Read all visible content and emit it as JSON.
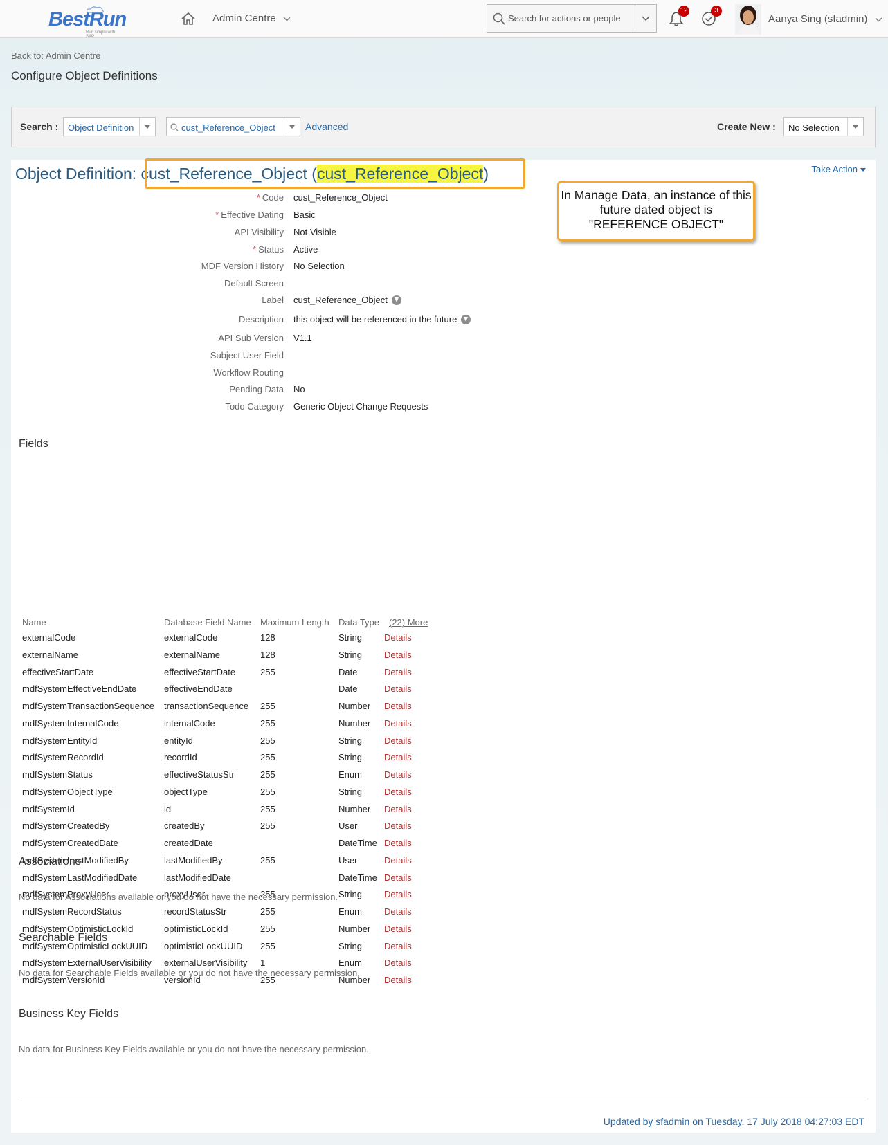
{
  "header": {
    "logo_text": "BestRun",
    "logo_tagline": "Run simple with SAP",
    "nav_title": "Admin Centre",
    "search_placeholder": "Search for actions or people",
    "notifications_count": "12",
    "approvals_count": "3",
    "user_name": "Aanya Sing (sfadmin)"
  },
  "breadcrumb": "Back to: Admin Centre",
  "page_title": "Configure Object Definitions",
  "search_bar": {
    "search_label": "Search :",
    "type_value": "Object Definition",
    "object_value": "cust_Reference_Object",
    "advanced_label": "Advanced",
    "create_new_label": "Create New :",
    "create_new_value": "No Selection"
  },
  "object": {
    "title_prefix": "Object Definition: ",
    "code_name": "cust_Reference_Object",
    "label_name": "cust_Reference_Object",
    "take_action": "Take Action",
    "callout": "In Manage Data, an instance of this future dated object is \"REFERENCE OBJECT\""
  },
  "properties": [
    {
      "label": "Code",
      "value": "cust_Reference_Object",
      "required": true
    },
    {
      "label": "Effective Dating",
      "value": "Basic",
      "required": true
    },
    {
      "label": "API Visibility",
      "value": "Not Visible",
      "required": false
    },
    {
      "label": "Status",
      "value": "Active",
      "required": true
    },
    {
      "label": "MDF Version History",
      "value": "No Selection",
      "required": false
    },
    {
      "label": "Default Screen",
      "value": "",
      "required": false
    },
    {
      "label": "Label",
      "value": "cust_Reference_Object",
      "required": false,
      "info": true
    },
    {
      "label": "Description",
      "value": "this object will be referenced in the future",
      "required": false,
      "info": true
    },
    {
      "label": "API Sub Version",
      "value": "V1.1",
      "required": false
    },
    {
      "label": "Subject User Field",
      "value": "",
      "required": false
    },
    {
      "label": "Workflow Routing",
      "value": "",
      "required": false
    },
    {
      "label": "Pending Data",
      "value": "No",
      "required": false
    },
    {
      "label": "Todo Category",
      "value": "Generic Object Change Requests",
      "required": false
    }
  ],
  "fields_section": {
    "title": "Fields",
    "columns": [
      "Name",
      "Database Field Name",
      "Maximum Length",
      "Data Type",
      "(22) More"
    ],
    "details_label": "Details",
    "rows": [
      [
        "externalCode",
        "externalCode",
        "128",
        "String"
      ],
      [
        "externalName",
        "externalName",
        "128",
        "String"
      ],
      [
        "effectiveStartDate",
        "effectiveStartDate",
        "255",
        "Date"
      ],
      [
        "mdfSystemEffectiveEndDate",
        "effectiveEndDate",
        "",
        "Date"
      ],
      [
        "mdfSystemTransactionSequence",
        "transactionSequence",
        "255",
        "Number"
      ],
      [
        "mdfSystemInternalCode",
        "internalCode",
        "255",
        "Number"
      ],
      [
        "mdfSystemEntityId",
        "entityId",
        "255",
        "String"
      ],
      [
        "mdfSystemRecordId",
        "recordId",
        "255",
        "String"
      ],
      [
        "mdfSystemStatus",
        "effectiveStatusStr",
        "255",
        "Enum"
      ],
      [
        "mdfSystemObjectType",
        "objectType",
        "255",
        "String"
      ],
      [
        "mdfSystemId",
        "id",
        "255",
        "Number"
      ],
      [
        "mdfSystemCreatedBy",
        "createdBy",
        "255",
        "User"
      ],
      [
        "mdfSystemCreatedDate",
        "createdDate",
        "",
        "DateTime"
      ],
      [
        "mdfSystemLastModifiedBy",
        "lastModifiedBy",
        "255",
        "User"
      ],
      [
        "mdfSystemLastModifiedDate",
        "lastModifiedDate",
        "",
        "DateTime"
      ],
      [
        "mdfSystemProxyUser",
        "proxyUser",
        "255",
        "String"
      ],
      [
        "mdfSystemRecordStatus",
        "recordStatusStr",
        "255",
        "Enum"
      ],
      [
        "mdfSystemOptimisticLockId",
        "optimisticLockId",
        "255",
        "Number"
      ],
      [
        "mdfSystemOptimisticLockUUID",
        "optimisticLockUUID",
        "255",
        "String"
      ],
      [
        "mdfSystemExternalUserVisibility",
        "externalUserVisibility",
        "1",
        "Enum"
      ],
      [
        "mdfSystemVersionId",
        "versionId",
        "255",
        "Number"
      ]
    ]
  },
  "associations": {
    "title": "Associations",
    "empty": "No data for Associations available or you do not have the necessary permission."
  },
  "searchable": {
    "title": "Searchable Fields",
    "empty": "No data for Searchable Fields available or you do not have the necessary permission."
  },
  "business_key": {
    "title": "Business Key Fields",
    "empty": "No data for Business Key Fields available or you do not have the necessary permission."
  },
  "footer": {
    "updated": "Updated by sfadmin on Tuesday, 17 July 2018 04:27:03 EDT"
  },
  "colors": {
    "accent": "#2868a6",
    "highlight": "#f5f542",
    "callout_border": "#f0a830",
    "details": "#b03030",
    "badge": "#c90000"
  }
}
